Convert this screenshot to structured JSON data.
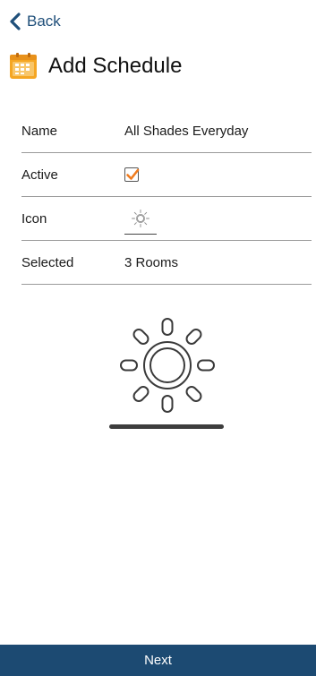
{
  "nav": {
    "back_label": "Back",
    "back_icon": "chevron-left-icon"
  },
  "header": {
    "title": "Add Schedule",
    "icon": "calendar-icon"
  },
  "form": {
    "name": {
      "label": "Name",
      "value": "All Shades Everyday"
    },
    "active": {
      "label": "Active",
      "checked": true
    },
    "icon": {
      "label": "Icon",
      "value_icon": "sun-icon"
    },
    "selected": {
      "label": "Selected",
      "value": "3 Rooms"
    }
  },
  "preview": {
    "icon": "sun-icon"
  },
  "footer": {
    "next_label": "Next"
  },
  "colors": {
    "accent": "#1f4f7a",
    "footer_bg": "#1c4a72",
    "checkbox_check": "#f07c1e",
    "calendar_orange": "#f5a623"
  }
}
